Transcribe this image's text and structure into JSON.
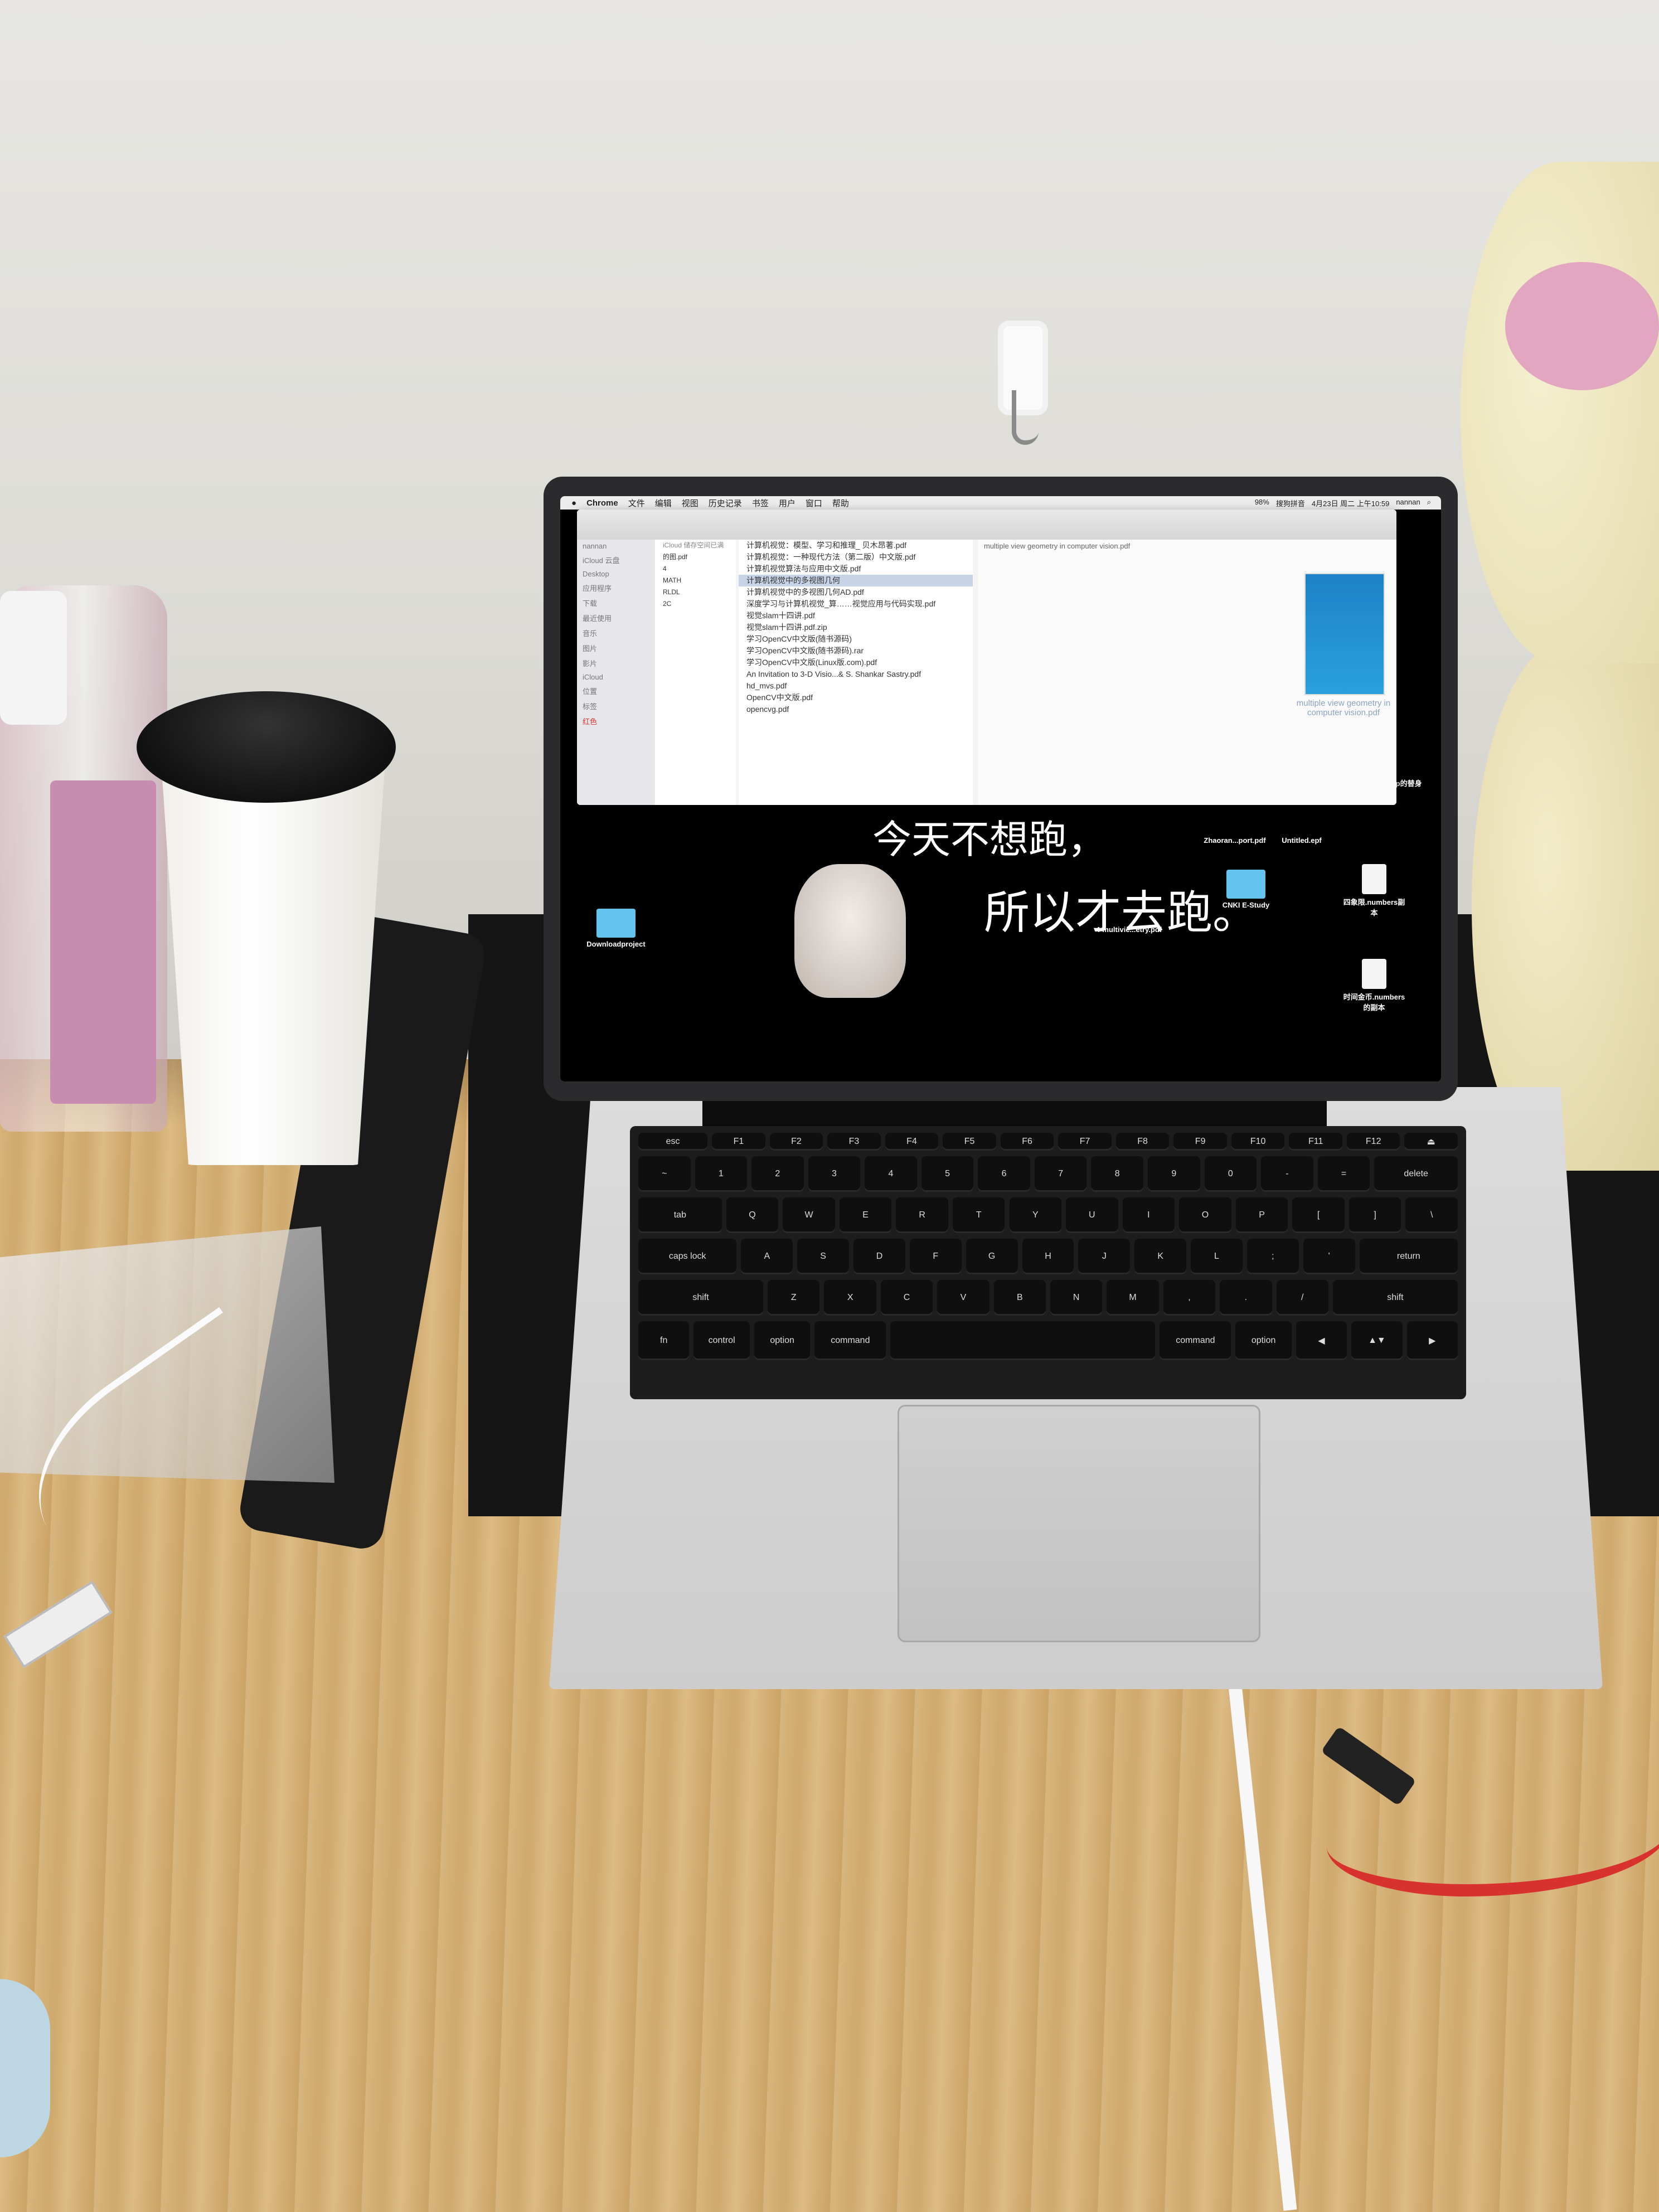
{
  "menubar": {
    "app": "Chrome",
    "items": [
      "文件",
      "编辑",
      "视图",
      "历史记录",
      "书签",
      "用户",
      "窗口",
      "帮助"
    ],
    "status": [
      "搜狗拼音",
      "4月23日 周二 上午10:59",
      "nannan"
    ],
    "battery": "98%"
  },
  "finder": {
    "location": "iCloud 储存空间已满",
    "sidebar": [
      "nannan",
      "iCloud 云盘",
      "Desktop",
      "应用程序",
      "下载",
      "最近使用",
      "音乐",
      "图片",
      "影片",
      "iCloud",
      "位置",
      "标签",
      "红色"
    ],
    "col1": [
      "的图.pdf",
      "4",
      "MATH",
      "RLDL",
      "2C"
    ],
    "files": [
      "计算机视觉：模型、学习和推理_ 贝木昂著.pdf",
      "计算机视觉：一种现代方法（第二版）中文版.pdf",
      "计算机视觉算法与应用中文版.pdf",
      "计算机视觉中的多视图几何",
      "计算机视觉中的多视图几何AD.pdf",
      "深度学习与计算机视觉_算……视觉应用与代码实现.pdf",
      "视觉slam十四讲.pdf",
      "视觉slam十四讲.pdf.zip",
      "学习OpenCV中文版(随书源码)",
      "学习OpenCV中文版(随书源码).rar",
      "学习OpenCV中文版(Linux版.com).pdf",
      "An Invitation to 3-D Visio...& S. Shankar Sastry.pdf",
      "hd_mvs.pdf",
      "OpenCV中文版.pdf",
      "opencvg.pdf"
    ],
    "selected_index": 3,
    "preview_path": "multiple view geometry in computer vision.pdf",
    "preview_caption": "multiple view geometry in computer vision.pdf"
  },
  "desktop": {
    "icons": [
      {
        "label": "Downloadproject",
        "kind": "folder"
      },
      {
        "label": "CNKI E-Study",
        "kind": "folder"
      },
      {
        "label": "Zhaoran...port.pdf",
        "kind": "file"
      },
      {
        "label": "Untitled.epf",
        "kind": "file"
      },
      {
        "label": "4-multivie...etry.pdf",
        "kind": "file"
      },
      {
        "label": "四象限.numbers副本",
        "kind": "numbers"
      },
      {
        "label": "时间金币.numbers的副本",
        "kind": "numbers"
      },
      {
        "label": "Eclipse.app的替身",
        "kind": "app"
      }
    ],
    "wallpaper_text": [
      "今天不想跑，",
      "所以才去跑。"
    ]
  },
  "keyboard": {
    "rows": [
      [
        "esc",
        "F1",
        "F2",
        "F3",
        "F4",
        "F5",
        "F6",
        "F7",
        "F8",
        "F9",
        "F10",
        "F11",
        "F12",
        "⏏"
      ],
      [
        "~",
        "1",
        "2",
        "3",
        "4",
        "5",
        "6",
        "7",
        "8",
        "9",
        "0",
        "-",
        "=",
        "delete"
      ],
      [
        "tab",
        "Q",
        "W",
        "E",
        "R",
        "T",
        "Y",
        "U",
        "I",
        "O",
        "P",
        "[",
        "]",
        "\\"
      ],
      [
        "caps lock",
        "A",
        "S",
        "D",
        "F",
        "G",
        "H",
        "J",
        "K",
        "L",
        ";",
        "'",
        "return"
      ],
      [
        "shift",
        "Z",
        "X",
        "C",
        "V",
        "B",
        "N",
        "M",
        ",",
        ".",
        "/",
        "shift"
      ],
      [
        "fn",
        "control",
        "option",
        "command",
        "",
        "command",
        "option",
        "◀",
        "▲▼",
        "▶"
      ]
    ]
  },
  "colors": {
    "wall": "#e2e1dc",
    "desk": "#d4b077",
    "laptop_aluminum": "#d2d2d2",
    "keycap": "#0f0f0f",
    "finder_selection": "#c7d3e6",
    "folder_blue": "#64c3ef",
    "red_cable": "#d8322e"
  }
}
